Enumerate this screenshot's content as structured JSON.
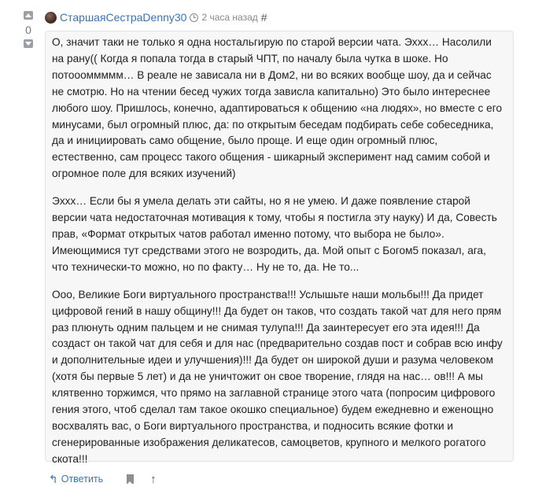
{
  "vote": {
    "count": "0"
  },
  "header": {
    "author": "СтаршаяСестраDenny30",
    "time": "2 часа назад",
    "permalink": "#"
  },
  "comment": {
    "paragraphs": [
      "О, значит таки не только я одна ностальгирую по старой версии чата. Эххх… Насолили на рану(( Когда я попала тогда в старый ЧПТ, по началу была чутка в шоке. Но потоооммммм… В реале не зависала ни в Дом2, ни во всяких вообще шоу, да и сейчас не смотрю. Но на чтении бесед чужих тогда зависла капитально) Это было интереснее любого шоу. Пришлось, конечно, адаптироваться к общению «на людях», но вместе с его минусами, был огромный плюс, да: по открытым беседам подбирать себе собеседника, да и инициировать само общение, было проще. И еще один огромный плюс, естественно, сам процесс такого общения - шикарный эксперимент над самим собой и огромное поле для всяких изучений)",
      "Эххх… Если бы я умела делать эти сайты, но я не умею. И даже появление старой версии чата недостаточная мотивация к тому, чтобы я постигла эту науку) И да, Совесть прав, «Формат открытых чатов работал именно потому, что выбора не было». Имеющимися тут средствами этого не возродить, да. Мой опыт с Богом5 показал, ага, что технически-то можно, но по факту… Ну не то, да. Не то...",
      "Ооо, Великие Боги виртуального пространства!!! Услышьте наши мольбы!!! Да придет цифровой гений в нашу общину!!! Да будет он таков, что создать такой чат для него прям раз плюнуть одним пальцем и не снимая тулупа!!! Да заинтересует его эта идея!!! Да создаст он такой чат для себя и для нас (предварительно создав пост и собрав всю инфу и дополнительные идеи и улучшения)!!! Да будет он широкой души и разума человеком (хотя бы первые 5 лет) и да не уничтожит он свое творение, глядя на нас… ов!!! А мы клятвенно торжимся, что прямо на заглавной странице этого чата (попросим цифрового гения этого, чтоб сделал там такое окошко специальное) будем ежедневно и еженощно восхвалять вас, о Боги виртуального пространства, и подносить всякие фотки и сгенерированные изображения деликатесов, самоцветов, крупного и мелкого рогатого скота!!!"
    ]
  },
  "actions": {
    "reply_label": "Ответить",
    "reply_icon_glyph": "↰",
    "up_glyph": "↑"
  },
  "icons": {
    "vote_up": "vote-up-icon",
    "vote_down": "vote-down-icon",
    "time": "clock-icon",
    "reply": "reply-icon",
    "bookmark": "bookmark-icon",
    "up": "arrow-up-icon"
  },
  "colors": {
    "link": "#3b73b9",
    "muted": "#888888",
    "box_bg": "#f7f7f7",
    "box_border": "#e3e3e3"
  }
}
